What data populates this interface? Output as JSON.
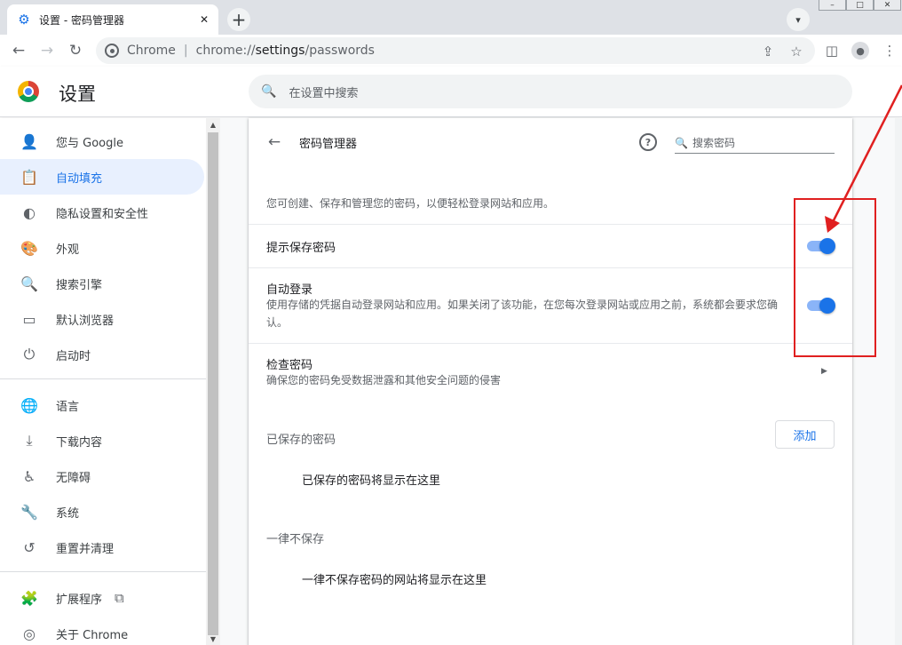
{
  "tab": {
    "icon": "gear-icon",
    "title": "设置 - 密码管理器",
    "close": "✕"
  },
  "newtab": "+",
  "window_controls": [
    "–",
    "□",
    "✕"
  ],
  "toolbar": {
    "back": "←",
    "forward": "→",
    "reload": "↻",
    "site": "Chrome",
    "url_prefix": "chrome://",
    "url_host": "settings",
    "url_path": "/passwords",
    "share": "⇪",
    "bookmark": "☆",
    "sidepanel": "◫",
    "profile": "●",
    "menu": "⋮"
  },
  "header": {
    "title": "设置",
    "search_placeholder": "在设置中搜索"
  },
  "sidebar": {
    "items": [
      {
        "label": "您与 Google",
        "icon": "person-icon",
        "glyph": "👤"
      },
      {
        "label": "自动填充",
        "icon": "clipboard-icon",
        "glyph": "📋"
      },
      {
        "label": "隐私设置和安全性",
        "icon": "shield-icon",
        "glyph": "◐"
      },
      {
        "label": "外观",
        "icon": "palette-icon",
        "glyph": "🎨"
      },
      {
        "label": "搜索引擎",
        "icon": "search-icon",
        "glyph": "🔍"
      },
      {
        "label": "默认浏览器",
        "icon": "browser-icon",
        "glyph": "▭"
      },
      {
        "label": "启动时",
        "icon": "power-icon",
        "glyph": "⏻"
      },
      {
        "label": "语言",
        "icon": "globe-icon",
        "glyph": "🌐"
      },
      {
        "label": "下载内容",
        "icon": "download-icon",
        "glyph": "⤓"
      },
      {
        "label": "无障碍",
        "icon": "accessibility-icon",
        "glyph": "♿"
      },
      {
        "label": "系统",
        "icon": "wrench-icon",
        "glyph": "🔧"
      },
      {
        "label": "重置并清理",
        "icon": "restore-icon",
        "glyph": "↺"
      },
      {
        "label": "扩展程序",
        "icon": "puzzle-icon",
        "glyph": "🧩"
      },
      {
        "label": "关于 Chrome",
        "icon": "chrome-icon",
        "glyph": "◎"
      }
    ],
    "ext_link_icon": "⧉"
  },
  "password_manager": {
    "title": "密码管理器",
    "search_placeholder": "搜索密码",
    "intro": "您可创建、保存和管理您的密码，以便轻松登录网站和应用。",
    "offer_to_save": {
      "label": "提示保存密码",
      "enabled": true
    },
    "auto_signin": {
      "label": "自动登录",
      "desc": "使用存储的凭据自动登录网站和应用。如果关闭了该功能，在您每次登录网站或应用之前，系统都会要求您确认。",
      "enabled": true
    },
    "check_passwords": {
      "label": "检查密码",
      "desc": "确保您的密码免受数据泄露和其他安全问题的侵害"
    },
    "saved": {
      "label": "已保存的密码",
      "add_button": "添加",
      "empty": "已保存的密码将显示在这里"
    },
    "never_saved": {
      "label": "一律不保存",
      "empty": "一律不保存密码的网站将显示在这里"
    }
  },
  "annotation": {
    "color": "#e02020"
  },
  "colors": {
    "accent": "#1a73e8",
    "toggle_track": "#8ab4f8",
    "active_nav_bg": "#e8f0fe"
  }
}
